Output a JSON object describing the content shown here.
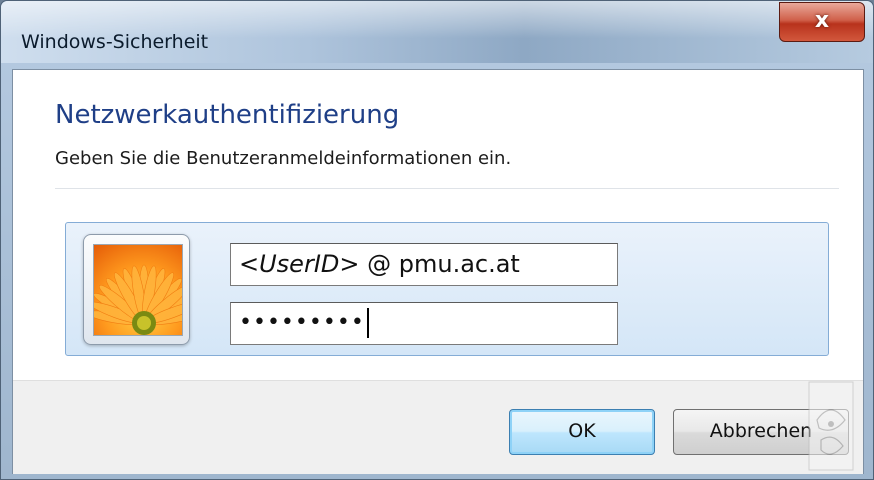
{
  "window": {
    "title": "Windows-Sicherheit",
    "close_label": "x"
  },
  "dialog": {
    "heading": "Netzwerkauthentifizierung",
    "instruction": "Geben Sie die Benutzeranmeldeinformationen ein."
  },
  "credentials": {
    "user_id_part": "<UserID>",
    "domain_part": " @ pmu.ac.at",
    "password_mask": "•••••••••"
  },
  "buttons": {
    "ok_label": "OK",
    "cancel_label": "Abbrechen"
  },
  "icons": {
    "avatar": "flower-avatar-icon",
    "watermark": "stamp-watermark-icon"
  }
}
